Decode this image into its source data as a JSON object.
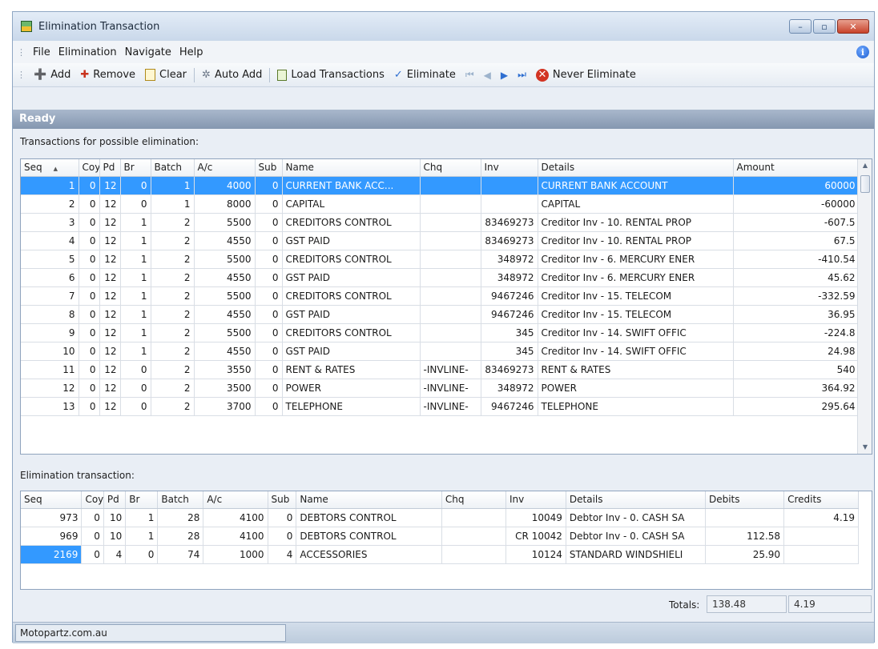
{
  "window": {
    "title": "Elimination Transaction",
    "min_label": "–",
    "max_label": "▫",
    "close_label": "✕"
  },
  "menu": {
    "items": [
      "File",
      "Elimination",
      "Navigate",
      "Help"
    ],
    "info_icon": "i"
  },
  "toolbar": {
    "add": "Add",
    "remove": "Remove",
    "clear": "Clear",
    "auto_add": "Auto Add",
    "load": "Load Transactions",
    "eliminate": "Eliminate",
    "never": "Never Eliminate",
    "icons": {
      "add": "add-icon",
      "remove": "remove-icon",
      "clear": "clear-icon",
      "auto_add": "wand-icon",
      "load": "load-icon",
      "eliminate": "checkmark-icon",
      "never": "x-circle-icon"
    }
  },
  "status": {
    "text": "Ready"
  },
  "possible": {
    "label": "Transactions for possible elimination:",
    "columns": [
      "Seq",
      "Coy",
      "Pd",
      "Br",
      "Batch",
      "A/c",
      "Sub",
      "Name",
      "Chq",
      "Inv",
      "Details",
      "Amount"
    ],
    "sort_indicator": "▲",
    "rows": [
      [
        "1",
        "0",
        "12",
        "0",
        "1",
        "4000",
        "0",
        "CURRENT BANK ACC...",
        "",
        "",
        "CURRENT BANK ACCOUNT",
        "60000"
      ],
      [
        "2",
        "0",
        "12",
        "0",
        "1",
        "8000",
        "0",
        "CAPITAL",
        "",
        "",
        "CAPITAL",
        "-60000"
      ],
      [
        "3",
        "0",
        "12",
        "1",
        "2",
        "5500",
        "0",
        "CREDITORS CONTROL",
        "",
        "83469273",
        "Creditor Inv - 10. RENTAL PROP",
        "-607.5"
      ],
      [
        "4",
        "0",
        "12",
        "1",
        "2",
        "4550",
        "0",
        "GST PAID",
        "",
        "83469273",
        "Creditor Inv - 10. RENTAL PROP",
        "67.5"
      ],
      [
        "5",
        "0",
        "12",
        "1",
        "2",
        "5500",
        "0",
        "CREDITORS CONTROL",
        "",
        "348972",
        "Creditor Inv - 6. MERCURY ENER",
        "-410.54"
      ],
      [
        "6",
        "0",
        "12",
        "1",
        "2",
        "4550",
        "0",
        "GST PAID",
        "",
        "348972",
        "Creditor Inv - 6. MERCURY ENER",
        "45.62"
      ],
      [
        "7",
        "0",
        "12",
        "1",
        "2",
        "5500",
        "0",
        "CREDITORS CONTROL",
        "",
        "9467246",
        "Creditor Inv - 15. TELECOM",
        "-332.59"
      ],
      [
        "8",
        "0",
        "12",
        "1",
        "2",
        "4550",
        "0",
        "GST PAID",
        "",
        "9467246",
        "Creditor Inv - 15. TELECOM",
        "36.95"
      ],
      [
        "9",
        "0",
        "12",
        "1",
        "2",
        "5500",
        "0",
        "CREDITORS CONTROL",
        "",
        "345",
        "Creditor Inv - 14. SWIFT OFFIC",
        "-224.8"
      ],
      [
        "10",
        "0",
        "12",
        "1",
        "2",
        "4550",
        "0",
        "GST PAID",
        "",
        "345",
        "Creditor Inv - 14. SWIFT OFFIC",
        "24.98"
      ],
      [
        "11",
        "0",
        "12",
        "0",
        "2",
        "3550",
        "0",
        "RENT & RATES",
        "-INVLINE-",
        "83469273",
        "RENT & RATES",
        "540"
      ],
      [
        "12",
        "0",
        "12",
        "0",
        "2",
        "3500",
        "0",
        "POWER",
        "-INVLINE-",
        "348972",
        "POWER",
        "364.92"
      ],
      [
        "13",
        "0",
        "12",
        "0",
        "2",
        "3700",
        "0",
        "TELEPHONE",
        "-INVLINE-",
        "9467246",
        "TELEPHONE",
        "295.64"
      ]
    ],
    "selected_row": 0
  },
  "elimination": {
    "label": "Elimination transaction:",
    "columns": [
      "Seq",
      "Coy",
      "Pd",
      "Br",
      "Batch",
      "A/c",
      "Sub",
      "Name",
      "Chq",
      "Inv",
      "Details",
      "Debits",
      "Credits"
    ],
    "rows": [
      [
        "973",
        "0",
        "10",
        "1",
        "28",
        "4100",
        "0",
        "DEBTORS CONTROL",
        "",
        "10049",
        "Debtor Inv - 0. CASH SA",
        "",
        "4.19"
      ],
      [
        "969",
        "0",
        "10",
        "1",
        "28",
        "4100",
        "0",
        "DEBTORS CONTROL",
        "",
        "CR 10042",
        "Debtor Inv - 0. CASH SA",
        "112.58",
        ""
      ],
      [
        "2169",
        "0",
        "4",
        "0",
        "74",
        "1000",
        "4",
        "ACCESSORIES",
        "",
        "10124",
        "STANDARD WINDSHIELI",
        "25.90",
        ""
      ]
    ]
  },
  "totals": {
    "label": "Totals:",
    "debits": "138.48",
    "credits": "4.19"
  },
  "footer": {
    "company": "Motopartz.com.au"
  }
}
